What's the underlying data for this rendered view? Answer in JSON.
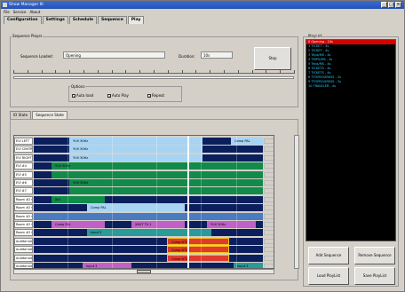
{
  "window": {
    "title": "Show Manager III"
  },
  "menu": [
    "File",
    "Service",
    "About"
  ],
  "tabs": [
    "Configuration",
    "Settings",
    "Schedule",
    "Sequence",
    "Play"
  ],
  "sequence_player": {
    "group_label": "Sequence Player",
    "loaded_label": "Sequence Loaded:",
    "loaded_value": "Opening",
    "duration_label": "Duration:",
    "duration_value": "10s",
    "stop_label": "Stop",
    "options_label": "Options",
    "options": [
      {
        "label": "Auto load",
        "checked": true
      },
      {
        "label": "Auto Play",
        "checked": true
      },
      {
        "label": "Repeat",
        "checked": true
      }
    ]
  },
  "state_tabs": [
    "IO State",
    "Sequence State"
  ],
  "playlist": {
    "label": "PlayList",
    "items": [
      "0 Opening - 10s",
      "1 TICKET - 4s",
      "2 TICKET - 4s",
      "3 Trips/MS - 4s",
      "4 TRIPS/MS - 4s",
      "5 Trips/MS - 4s",
      "6 TICKETS - 4s",
      "7 TICKETS - 4s",
      "8 TTOPROGRESS - 2s",
      "9 TTOPROGRESS - 3s",
      "10 TRAVELER - 4s"
    ],
    "selected_index": 0,
    "buttons": [
      "Add Sequence",
      "Remove Sequence",
      "Load PlayList",
      "Save PlayList"
    ]
  },
  "rows": [
    {
      "label": "EVI LEFT",
      "segs": [
        {
          "text": "YUV 50Hz",
          "color": "#a8d4f4"
        },
        {
          "text": "Comp PAL",
          "color": "#a8d4f4"
        }
      ]
    },
    {
      "label": "EVI CENTRE",
      "segs": [
        {
          "text": "YUV 50Hz",
          "color": "#a8d4f4"
        }
      ]
    },
    {
      "label": "EVI RIGHT",
      "segs": [
        {
          "text": "YUV 50Hz",
          "color": "#a8d4f4"
        }
      ]
    },
    {
      "label": "EVI #4",
      "segs": [
        {
          "text": "YUV 50Hz",
          "color": "#118a4a"
        }
      ]
    },
    {
      "label": "EVI #5",
      "segs": [
        {
          "text": "",
          "color": "#118a4a"
        }
      ]
    },
    {
      "label": "EVI #6",
      "segs": [
        {
          "text": "YUV 50Hz",
          "color": "#118a4a"
        }
      ]
    },
    {
      "label": "EVI #7",
      "segs": [
        {
          "text": "",
          "color": "#118a4a"
        }
      ]
    },
    {
      "label": "Room #2 C1",
      "segs": [
        {
          "text": "XVI",
          "color": "#118a4a"
        }
      ]
    },
    {
      "label": "Room #2 C2",
      "segs": [
        {
          "text": "Comp PAL",
          "color": "#a8d4f4"
        }
      ]
    },
    {
      "label": "Room #2 C3",
      "segs": [
        {
          "text": "",
          "color": "#4a7ac0"
        }
      ]
    },
    {
      "label": "Room #2 C4",
      "segs": [
        {
          "text": "Comp PAL",
          "color": "#c060c8"
        },
        {
          "text": "XNVT TX 1",
          "color": "#c060c8"
        },
        {
          "text": "YUV 50Hz",
          "color": "#c060c8"
        }
      ]
    },
    {
      "label": "Room #2 C5",
      "segs": [
        {
          "text": "Input 3",
          "color": "#2a9a9a"
        }
      ]
    },
    {
      "label": "Auditorium C1",
      "segs": [
        {
          "text": "Comp NTSC",
          "color": "#e03a2a"
        }
      ]
    },
    {
      "label": "Auditorium C2",
      "segs": [
        {
          "text": "Comp NTSC",
          "color": "#e03a2a"
        }
      ]
    },
    {
      "label": "Auditorium C3",
      "segs": [
        {
          "text": "Comp NTSC",
          "color": "#e03a2a"
        }
      ]
    },
    {
      "label": "Auditorium C4",
      "segs": [
        {
          "text": "Input 3",
          "color": "#c060c8"
        },
        {
          "text": "Input 3",
          "color": "#2a9a9a"
        }
      ]
    }
  ],
  "colors": {
    "lane_bg": "#0a1f5c",
    "playlist_bg": "#000000",
    "playlist_sel": "#d40000",
    "playlist_text": "#2bd0ff"
  }
}
